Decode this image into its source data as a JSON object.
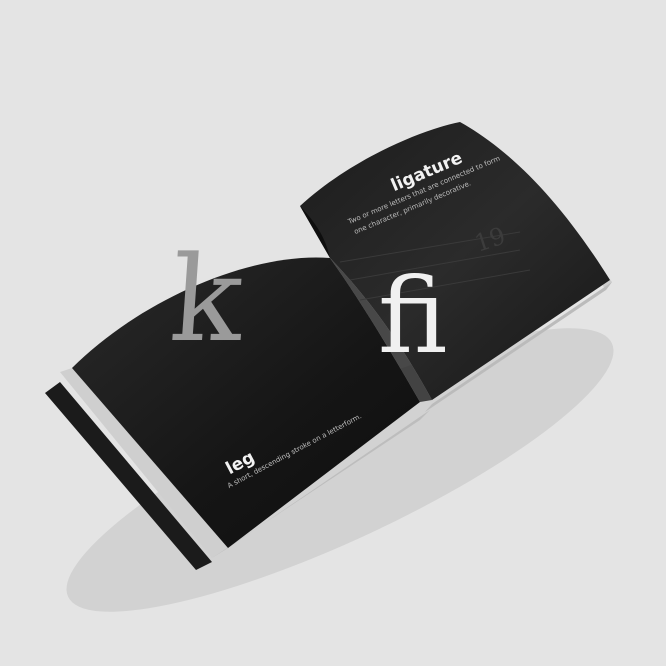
{
  "left_page": {
    "glyph": "k",
    "term": "leg",
    "description": "A short, descending stroke on a letterform."
  },
  "right_page": {
    "glyph": "fi",
    "term": "ligature",
    "description_line1": "Two or more letters that are connected to form",
    "description_line2": "one character, primarily decorative.",
    "page_number": "19"
  },
  "colors": {
    "background": "#e4e4e4",
    "page_dark": "#1a1a1a",
    "page_edge": "#c8c8c8",
    "glyph_k": "#9a9a9a",
    "glyph_fi": "#f0f0f0"
  }
}
